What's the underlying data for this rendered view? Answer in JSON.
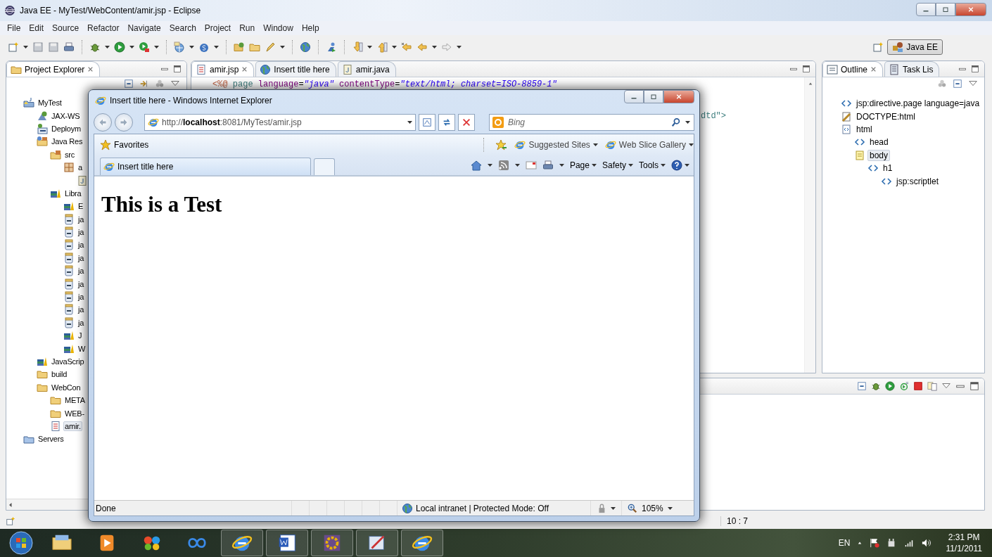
{
  "window": {
    "title": "Java EE - MyTest/WebContent/amir.jsp - Eclipse"
  },
  "menu": [
    "File",
    "Edit",
    "Source",
    "Refactor",
    "Navigate",
    "Search",
    "Project",
    "Run",
    "Window",
    "Help"
  ],
  "perspective": {
    "label": "Java EE",
    "selected": true
  },
  "project_explorer": {
    "tab": {
      "label": "Project Explorer",
      "selected": true
    },
    "tree": [
      {
        "label": "MyTest",
        "kind": "project",
        "selected": false,
        "children": [
          {
            "label": "JAX-WS",
            "kind": "webservice",
            "selected": false
          },
          {
            "label": "Deploym",
            "kind": "deploy",
            "selected": false
          },
          {
            "label": "Java Res",
            "kind": "javares",
            "selected": false,
            "children": [
              {
                "label": "src",
                "kind": "srcfolder",
                "selected": false,
                "children": [
                  {
                    "label": "a",
                    "kind": "package",
                    "selected": false,
                    "children": [
                      {
                        "kind": "javafile",
                        "selected": false
                      }
                    ]
                  }
                ]
              },
              {
                "label": "Libra",
                "kind": "library",
                "selected": false,
                "children": [
                  {
                    "label": "E",
                    "kind": "library",
                    "selected": false
                  },
                  {
                    "label": "ja",
                    "kind": "jar",
                    "selected": false
                  },
                  {
                    "label": "ja",
                    "kind": "jar",
                    "selected": false
                  },
                  {
                    "label": "ja",
                    "kind": "jar",
                    "selected": false
                  },
                  {
                    "label": "ja",
                    "kind": "jar",
                    "selected": false
                  },
                  {
                    "label": "ja",
                    "kind": "jar",
                    "selected": false
                  },
                  {
                    "label": "ja",
                    "kind": "jar",
                    "selected": false
                  },
                  {
                    "label": "ja",
                    "kind": "jar",
                    "selected": false
                  },
                  {
                    "label": "ja",
                    "kind": "jar",
                    "selected": false
                  },
                  {
                    "label": "ja",
                    "kind": "jar",
                    "selected": false
                  },
                  {
                    "label": "J",
                    "kind": "library",
                    "selected": false
                  },
                  {
                    "label": "W",
                    "kind": "library",
                    "selected": false
                  }
                ]
              }
            ]
          },
          {
            "label": "JavaScrip",
            "kind": "library",
            "selected": false
          },
          {
            "label": "build",
            "kind": "folder",
            "selected": false
          },
          {
            "label": "WebCon",
            "kind": "folder",
            "selected": false,
            "children": [
              {
                "label": "META",
                "kind": "folder",
                "selected": false
              },
              {
                "label": "WEB-",
                "kind": "folder",
                "selected": false
              },
              {
                "label": "amir.",
                "kind": "jsp",
                "selected": true
              }
            ]
          }
        ]
      },
      {
        "label": "Servers",
        "kind": "servers",
        "selected": false
      }
    ]
  },
  "editor": {
    "tabs": [
      {
        "label": "amir.jsp",
        "kind": "jsp",
        "selected": true
      },
      {
        "label": "Insert title here",
        "kind": "web",
        "selected": false
      },
      {
        "label": "amir.java",
        "kind": "java",
        "selected": false
      }
    ],
    "lines": [
      {
        "kind": "full",
        "tokens": [
          {
            "text": "<%@ ",
            "kind": "delim"
          },
          {
            "text": "page ",
            "kind": "directive"
          },
          {
            "text": "language",
            "kind": "attr"
          },
          {
            "text": "=",
            "kind": "plain"
          },
          {
            "text": "\"java\" ",
            "kind": "value"
          },
          {
            "text": "contentType",
            "kind": "attr"
          },
          {
            "text": "=",
            "kind": "plain"
          },
          {
            "text": "\"text/html; charset=ISO-8859-1\"",
            "kind": "value"
          }
        ]
      },
      {
        "kind": "tail",
        "tokens": [
          {
            "text": "dtd\">",
            "kind": "markup"
          }
        ]
      }
    ]
  },
  "outline": {
    "tabs": [
      {
        "label": "Outline",
        "kind": "outline",
        "selected": true
      },
      {
        "label": "Task Lis",
        "kind": "tasks",
        "selected": false
      }
    ],
    "tree": [
      {
        "label": "jsp:directive.page language=java",
        "kind": "tag",
        "selected": false
      },
      {
        "label": "DOCTYPE:html",
        "kind": "doctype",
        "selected": false
      },
      {
        "label": "html",
        "kind": "html",
        "selected": false,
        "children": [
          {
            "label": "head",
            "kind": "tag",
            "selected": false
          },
          {
            "label": "body",
            "kind": "body",
            "selected": true,
            "children": [
              {
                "label": "h1",
                "kind": "tag",
                "selected": false,
                "children": [
                  {
                    "label": "jsp:scriptlet",
                    "kind": "tag",
                    "selected": false
                  }
                ]
              }
            ]
          }
        ]
      }
    ]
  },
  "status_bar": {
    "position": "10 : 7"
  },
  "browser": {
    "title": "Insert title here - Windows Internet Explorer",
    "address": "http://**localhost**:8081/MyTest/amir.jsp",
    "search": {
      "placeholder": "Bing"
    },
    "favorites": [
      {
        "label": "Favorites",
        "kind": "favorites"
      },
      {
        "label": "Suggested Sites",
        "kind": "feed"
      },
      {
        "label": "Web Slice Gallery",
        "kind": "feed"
      }
    ],
    "tabs": [
      {
        "label": "Insert title here",
        "selected": true
      }
    ],
    "commands": [
      "Page",
      "Safety",
      "Tools"
    ],
    "heading": "This is a Test",
    "status": {
      "text": "Done",
      "zone": "Local intranet | Protected Mode: Off",
      "zoom": "105%"
    }
  },
  "taskbar": {
    "apps": [
      {
        "kind": "explorer",
        "running": false
      },
      {
        "kind": "media",
        "running": false
      },
      {
        "kind": "paint",
        "running": false
      },
      {
        "kind": "infinity",
        "running": false
      },
      {
        "kind": "ie",
        "running": true
      },
      {
        "kind": "word",
        "running": true
      },
      {
        "kind": "javaee",
        "running": true
      },
      {
        "kind": "snip",
        "running": true
      },
      {
        "kind": "ie",
        "running": true
      }
    ],
    "language": "EN",
    "time": "2:31 PM",
    "date": "11/1/2011"
  }
}
